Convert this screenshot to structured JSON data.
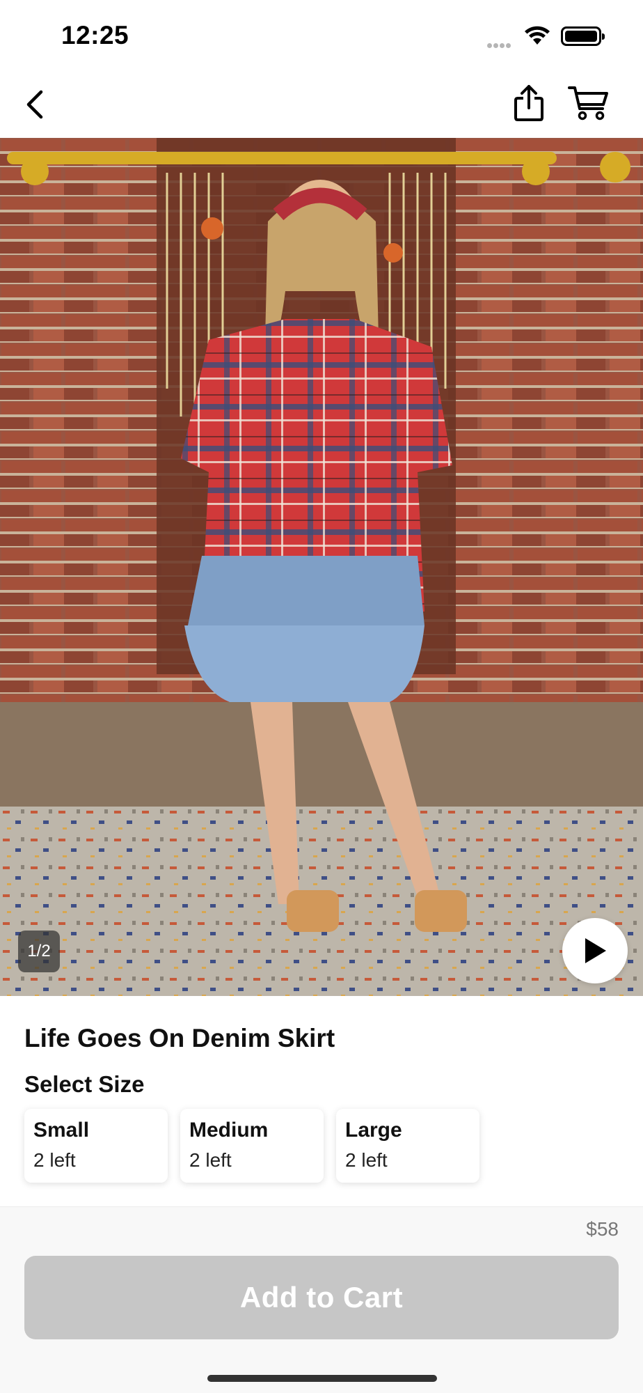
{
  "status_bar": {
    "time": "12:25"
  },
  "nav": {
    "back_icon": "chevron-left-icon",
    "share_icon": "share-icon",
    "cart_icon": "shopping-cart-icon"
  },
  "gallery": {
    "page_indicator": "1/2",
    "play_icon": "play-icon"
  },
  "product": {
    "title": "Life Goes On Denim Skirt",
    "select_size_label": "Select Size",
    "sizes": [
      {
        "name": "Small",
        "stock": "2 left"
      },
      {
        "name": "Medium",
        "stock": "2 left"
      },
      {
        "name": "Large",
        "stock": "2 left"
      }
    ],
    "price": "$58",
    "add_to_cart_label": "Add to Cart"
  },
  "colors": {
    "button_disabled": "#c6c6c6",
    "price_text": "#777777"
  }
}
